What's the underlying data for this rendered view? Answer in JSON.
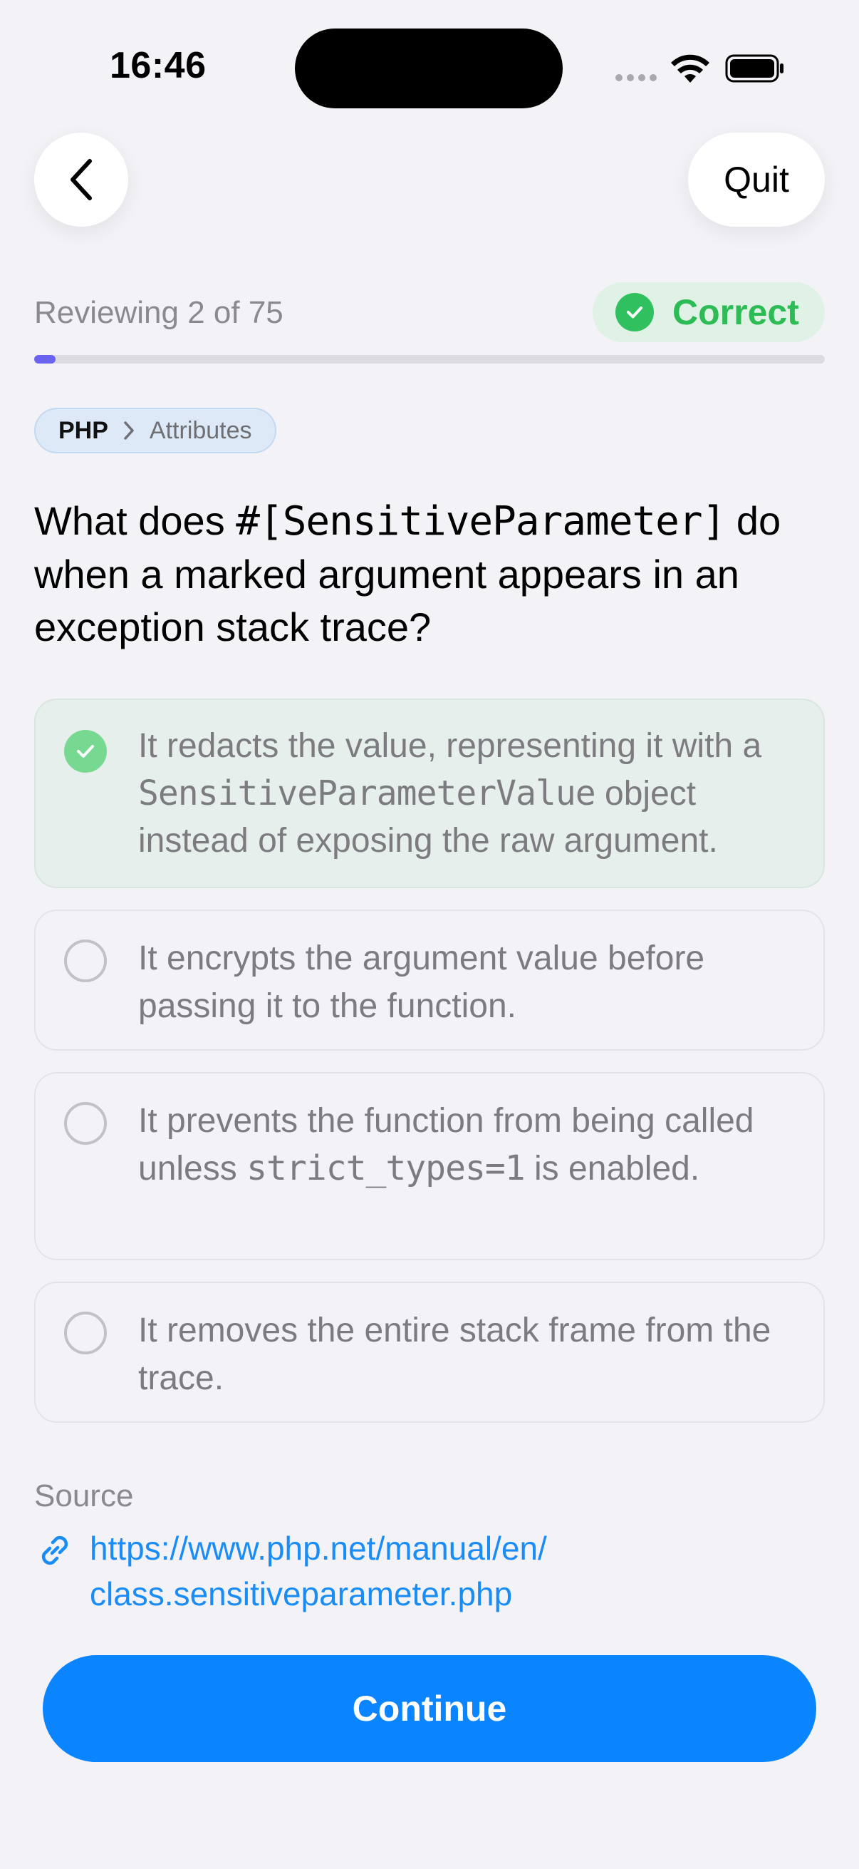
{
  "status_bar": {
    "time": "16:46"
  },
  "nav": {
    "back_icon": "chevron-left-icon",
    "quit_label": "Quit"
  },
  "progress": {
    "reviewing_text": "Reviewing 2 of 75",
    "current": 2,
    "total": 75,
    "fraction": 0.027
  },
  "result": {
    "label": "Correct",
    "icon": "check-circle-icon",
    "color": "#2dbb56"
  },
  "breadcrumb": {
    "primary": "PHP",
    "secondary": "Attributes"
  },
  "question": {
    "part1": "What does ",
    "code": "#[SensitiveParameter]",
    "part2": " do when a marked argument appears in an exception stack trace?"
  },
  "options": [
    {
      "state": "correct",
      "before": "It redacts the value, representing it with a ",
      "code": "SensitiveParameterValue",
      "after": " object instead of exposing the raw argument."
    },
    {
      "state": "unselected",
      "before": "It encrypts the argument value before passing it to the function.",
      "code": "",
      "after": ""
    },
    {
      "state": "unselected",
      "before": "It prevents the function from being called unless ",
      "code": "strict_types=1",
      "after": " is enabled."
    },
    {
      "state": "unselected",
      "before": "It removes the entire stack frame from the trace.",
      "code": "",
      "after": ""
    }
  ],
  "source": {
    "label": "Source",
    "url_line1": "https://www.php.net/manual/en/",
    "url_line2": "class.sensitiveparameter.php"
  },
  "continue_label": "Continue",
  "colors": {
    "accent": "#0a84ff",
    "progress": "#6a63f2",
    "success": "#30c060"
  }
}
